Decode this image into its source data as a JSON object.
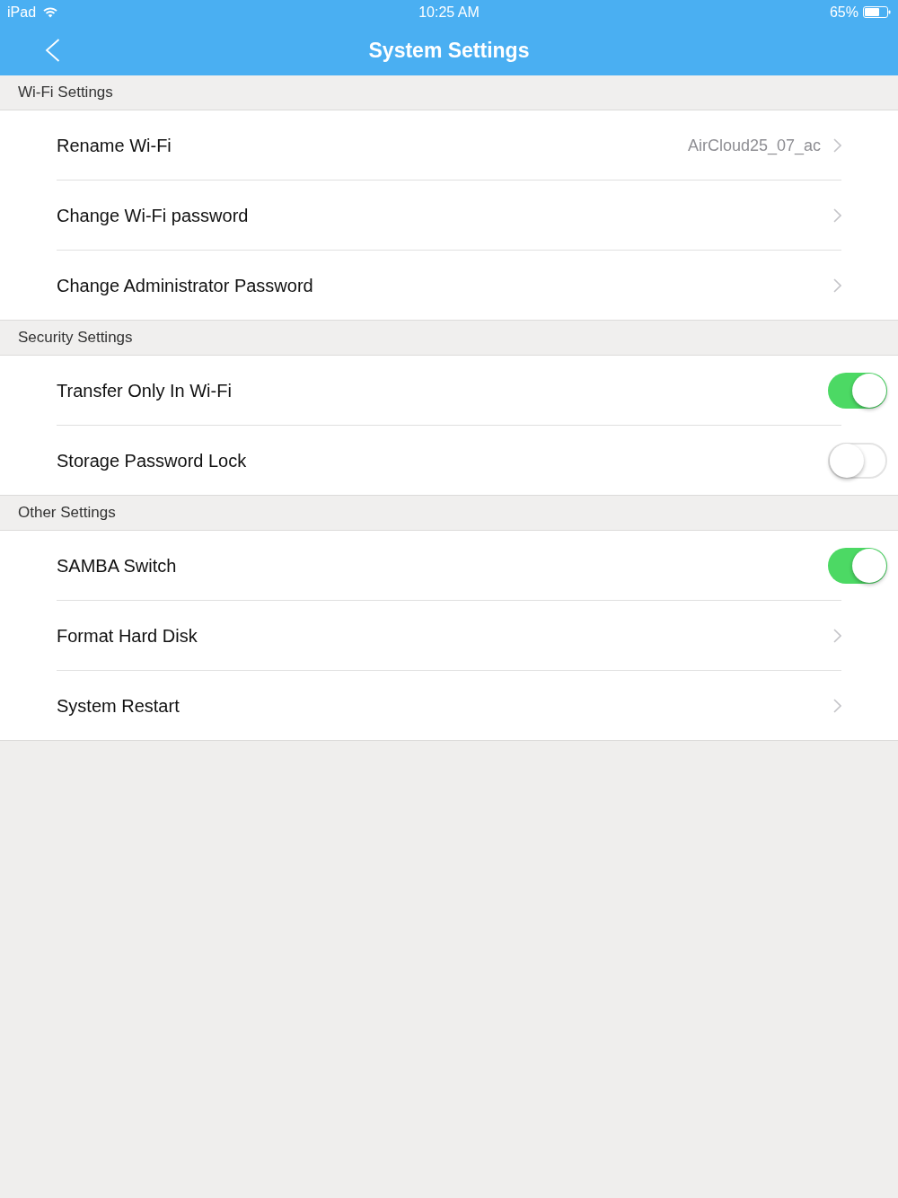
{
  "status_bar": {
    "device": "iPad",
    "time": "10:25 AM",
    "battery": "65%"
  },
  "nav_bar": {
    "title": "System Settings"
  },
  "sections": [
    {
      "title": "Wi-Fi Settings",
      "items": [
        {
          "kind": "link",
          "label": "Rename Wi-Fi",
          "value": "AirCloud25_07_ac"
        },
        {
          "kind": "link",
          "label": "Change Wi-Fi password"
        },
        {
          "kind": "link",
          "label": "Change Administrator Password"
        }
      ]
    },
    {
      "title": "Security Settings",
      "items": [
        {
          "kind": "toggle",
          "label": "Transfer Only In Wi-Fi",
          "on": true
        },
        {
          "kind": "toggle",
          "label": "Storage Password Lock",
          "on": false
        }
      ]
    },
    {
      "title": "Other Settings",
      "items": [
        {
          "kind": "toggle",
          "label": "SAMBA Switch",
          "on": true
        },
        {
          "kind": "link",
          "label": "Format Hard Disk"
        },
        {
          "kind": "link",
          "label": "System Restart"
        }
      ]
    }
  ]
}
